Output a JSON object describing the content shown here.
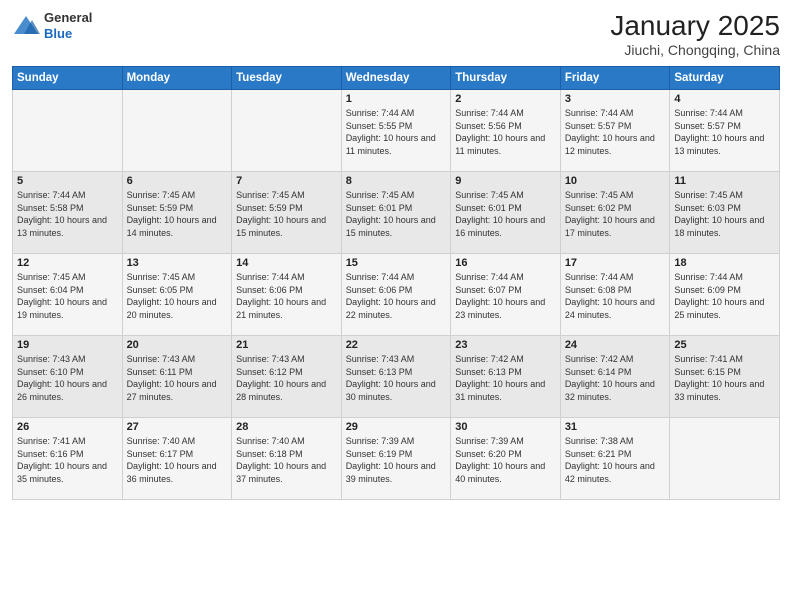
{
  "logo": {
    "general": "General",
    "blue": "Blue"
  },
  "title": "January 2025",
  "subtitle": "Jiuchi, Chongqing, China",
  "weekdays": [
    "Sunday",
    "Monday",
    "Tuesday",
    "Wednesday",
    "Thursday",
    "Friday",
    "Saturday"
  ],
  "weeks": [
    [
      {
        "day": "",
        "info": ""
      },
      {
        "day": "",
        "info": ""
      },
      {
        "day": "",
        "info": ""
      },
      {
        "day": "1",
        "info": "Sunrise: 7:44 AM\nSunset: 5:55 PM\nDaylight: 10 hours and 11 minutes."
      },
      {
        "day": "2",
        "info": "Sunrise: 7:44 AM\nSunset: 5:56 PM\nDaylight: 10 hours and 11 minutes."
      },
      {
        "day": "3",
        "info": "Sunrise: 7:44 AM\nSunset: 5:57 PM\nDaylight: 10 hours and 12 minutes."
      },
      {
        "day": "4",
        "info": "Sunrise: 7:44 AM\nSunset: 5:57 PM\nDaylight: 10 hours and 13 minutes."
      }
    ],
    [
      {
        "day": "5",
        "info": "Sunrise: 7:44 AM\nSunset: 5:58 PM\nDaylight: 10 hours and 13 minutes."
      },
      {
        "day": "6",
        "info": "Sunrise: 7:45 AM\nSunset: 5:59 PM\nDaylight: 10 hours and 14 minutes."
      },
      {
        "day": "7",
        "info": "Sunrise: 7:45 AM\nSunset: 5:59 PM\nDaylight: 10 hours and 15 minutes."
      },
      {
        "day": "8",
        "info": "Sunrise: 7:45 AM\nSunset: 6:01 PM\nDaylight: 10 hours and 15 minutes."
      },
      {
        "day": "9",
        "info": "Sunrise: 7:45 AM\nSunset: 6:01 PM\nDaylight: 10 hours and 16 minutes."
      },
      {
        "day": "10",
        "info": "Sunrise: 7:45 AM\nSunset: 6:02 PM\nDaylight: 10 hours and 17 minutes."
      },
      {
        "day": "11",
        "info": "Sunrise: 7:45 AM\nSunset: 6:03 PM\nDaylight: 10 hours and 18 minutes."
      }
    ],
    [
      {
        "day": "12",
        "info": "Sunrise: 7:45 AM\nSunset: 6:04 PM\nDaylight: 10 hours and 19 minutes."
      },
      {
        "day": "13",
        "info": "Sunrise: 7:45 AM\nSunset: 6:05 PM\nDaylight: 10 hours and 20 minutes."
      },
      {
        "day": "14",
        "info": "Sunrise: 7:44 AM\nSunset: 6:06 PM\nDaylight: 10 hours and 21 minutes."
      },
      {
        "day": "15",
        "info": "Sunrise: 7:44 AM\nSunset: 6:06 PM\nDaylight: 10 hours and 22 minutes."
      },
      {
        "day": "16",
        "info": "Sunrise: 7:44 AM\nSunset: 6:07 PM\nDaylight: 10 hours and 23 minutes."
      },
      {
        "day": "17",
        "info": "Sunrise: 7:44 AM\nSunset: 6:08 PM\nDaylight: 10 hours and 24 minutes."
      },
      {
        "day": "18",
        "info": "Sunrise: 7:44 AM\nSunset: 6:09 PM\nDaylight: 10 hours and 25 minutes."
      }
    ],
    [
      {
        "day": "19",
        "info": "Sunrise: 7:43 AM\nSunset: 6:10 PM\nDaylight: 10 hours and 26 minutes."
      },
      {
        "day": "20",
        "info": "Sunrise: 7:43 AM\nSunset: 6:11 PM\nDaylight: 10 hours and 27 minutes."
      },
      {
        "day": "21",
        "info": "Sunrise: 7:43 AM\nSunset: 6:12 PM\nDaylight: 10 hours and 28 minutes."
      },
      {
        "day": "22",
        "info": "Sunrise: 7:43 AM\nSunset: 6:13 PM\nDaylight: 10 hours and 30 minutes."
      },
      {
        "day": "23",
        "info": "Sunrise: 7:42 AM\nSunset: 6:13 PM\nDaylight: 10 hours and 31 minutes."
      },
      {
        "day": "24",
        "info": "Sunrise: 7:42 AM\nSunset: 6:14 PM\nDaylight: 10 hours and 32 minutes."
      },
      {
        "day": "25",
        "info": "Sunrise: 7:41 AM\nSunset: 6:15 PM\nDaylight: 10 hours and 33 minutes."
      }
    ],
    [
      {
        "day": "26",
        "info": "Sunrise: 7:41 AM\nSunset: 6:16 PM\nDaylight: 10 hours and 35 minutes."
      },
      {
        "day": "27",
        "info": "Sunrise: 7:40 AM\nSunset: 6:17 PM\nDaylight: 10 hours and 36 minutes."
      },
      {
        "day": "28",
        "info": "Sunrise: 7:40 AM\nSunset: 6:18 PM\nDaylight: 10 hours and 37 minutes."
      },
      {
        "day": "29",
        "info": "Sunrise: 7:39 AM\nSunset: 6:19 PM\nDaylight: 10 hours and 39 minutes."
      },
      {
        "day": "30",
        "info": "Sunrise: 7:39 AM\nSunset: 6:20 PM\nDaylight: 10 hours and 40 minutes."
      },
      {
        "day": "31",
        "info": "Sunrise: 7:38 AM\nSunset: 6:21 PM\nDaylight: 10 hours and 42 minutes."
      },
      {
        "day": "",
        "info": ""
      }
    ]
  ]
}
